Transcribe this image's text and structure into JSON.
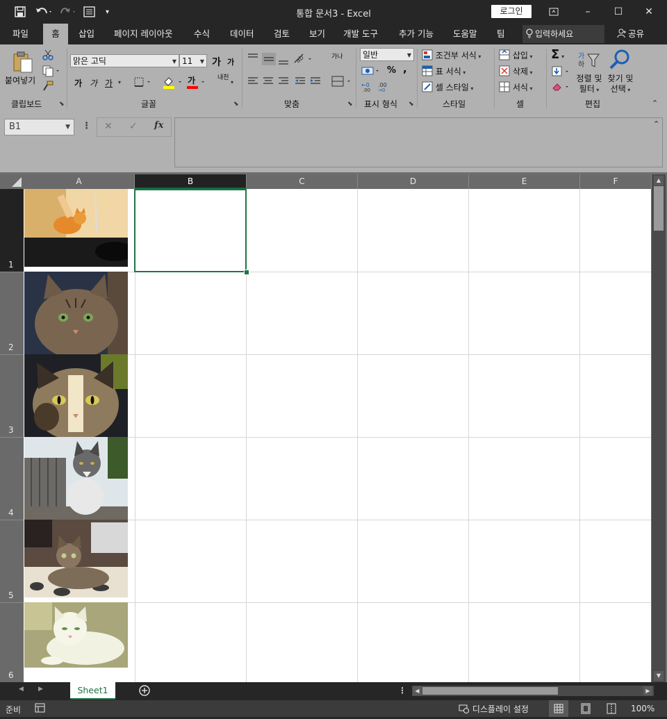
{
  "window": {
    "title": "통합 문서3  -  Excel",
    "login_label": "로그인"
  },
  "tabs": [
    "파일",
    "홈",
    "삽입",
    "페이지 레이아웃",
    "수식",
    "데이터",
    "검토",
    "보기",
    "개발 도구",
    "추가 기능",
    "도움말",
    "팀"
  ],
  "active_tab": "홈",
  "tell_me_placeholder": "입력하세요",
  "share_label": "공유",
  "ribbon": {
    "clipboard": {
      "paste_label": "붙여넣기",
      "group_label": "클립보드"
    },
    "font": {
      "font_name": "맑은 고딕",
      "font_size": "11",
      "bold": "가",
      "italic": "가",
      "underline": "가",
      "grow": "가",
      "shrink": "가",
      "font_color_glyph": "가",
      "phonetic": "내천",
      "group_label": "글꼴"
    },
    "alignment": {
      "wrap_glyph": "가나",
      "group_label": "맞춤"
    },
    "number": {
      "format": "일반",
      "percent": "%",
      "comma": ",",
      "group_label": "표시 형식"
    },
    "styles": {
      "conditional": "조건부 서식",
      "table": "표 서식",
      "cell_styles": "셀 스타일",
      "group_label": "스타일"
    },
    "cells": {
      "insert": "삽입",
      "delete": "삭제",
      "format": "서식",
      "group_label": "셀"
    },
    "editing": {
      "sort_line1": "정렬 및",
      "sort_line2": "필터",
      "find_line1": "찾기 및",
      "find_line2": "선택",
      "group_label": "편집"
    }
  },
  "formula_bar": {
    "name_box": "B1",
    "formula": "",
    "fx": "fx"
  },
  "grid": {
    "columns": [
      "A",
      "B",
      "C",
      "D",
      "E",
      "F"
    ],
    "rows": [
      "1",
      "2",
      "3",
      "4",
      "5",
      "6"
    ],
    "selected_cell": "B1",
    "column_a_images": [
      "orange kitten on table",
      "tabby cat portrait",
      "tortoiseshell cat face",
      "gray and white kitten on porch",
      "tabby kitten on blanket",
      "white cat lying down"
    ]
  },
  "sheets": [
    "Sheet1"
  ],
  "status": {
    "ready": "준비",
    "display_settings": "디스플레이 설정",
    "zoom": "100%"
  },
  "colors": {
    "accent": "#217346",
    "titlebar": "#262626",
    "ribbon": "#b1b1b1"
  }
}
